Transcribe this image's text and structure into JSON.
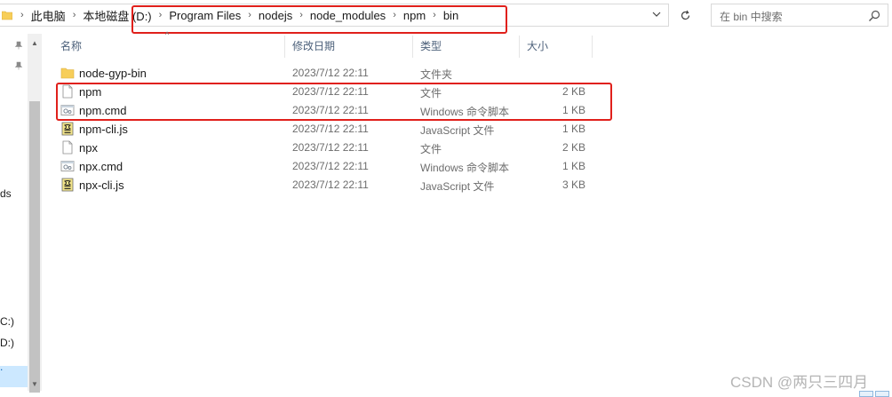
{
  "address_bar": {
    "crumbs": [
      "此电脑",
      "本地磁盘 (D:)",
      "Program Files",
      "nodejs",
      "node_modules",
      "npm",
      "bin"
    ]
  },
  "search": {
    "placeholder": "在 bin 中搜索"
  },
  "nav": {
    "labels": {
      "a": "ds",
      "b": "C:)",
      "c": "D:)"
    }
  },
  "columns": {
    "name": "名称",
    "date": "修改日期",
    "type": "类型",
    "size": "大小"
  },
  "files": [
    {
      "name": "node-gyp-bin",
      "date": "2023/7/12 22:11",
      "type": "文件夹",
      "size": "",
      "icon": "folder-icon"
    },
    {
      "name": "npm",
      "date": "2023/7/12 22:11",
      "type": "文件",
      "size": "2 KB",
      "icon": "file-icon"
    },
    {
      "name": "npm.cmd",
      "date": "2023/7/12 22:11",
      "type": "Windows 命令脚本",
      "size": "1 KB",
      "icon": "cmd-script-icon"
    },
    {
      "name": "npm-cli.js",
      "date": "2023/7/12 22:11",
      "type": "JavaScript 文件",
      "size": "1 KB",
      "icon": "js-file-icon"
    },
    {
      "name": "npx",
      "date": "2023/7/12 22:11",
      "type": "文件",
      "size": "2 KB",
      "icon": "file-icon"
    },
    {
      "name": "npx.cmd",
      "date": "2023/7/12 22:11",
      "type": "Windows 命令脚本",
      "size": "1 KB",
      "icon": "cmd-script-icon"
    },
    {
      "name": "npx-cli.js",
      "date": "2023/7/12 22:11",
      "type": "JavaScript 文件",
      "size": "3 KB",
      "icon": "js-file-icon"
    }
  ],
  "watermark": "CSDN @两只三四月",
  "colors": {
    "annotation": "#e0201b",
    "selection": "#cce8ff",
    "folder": "#f7ce59"
  }
}
